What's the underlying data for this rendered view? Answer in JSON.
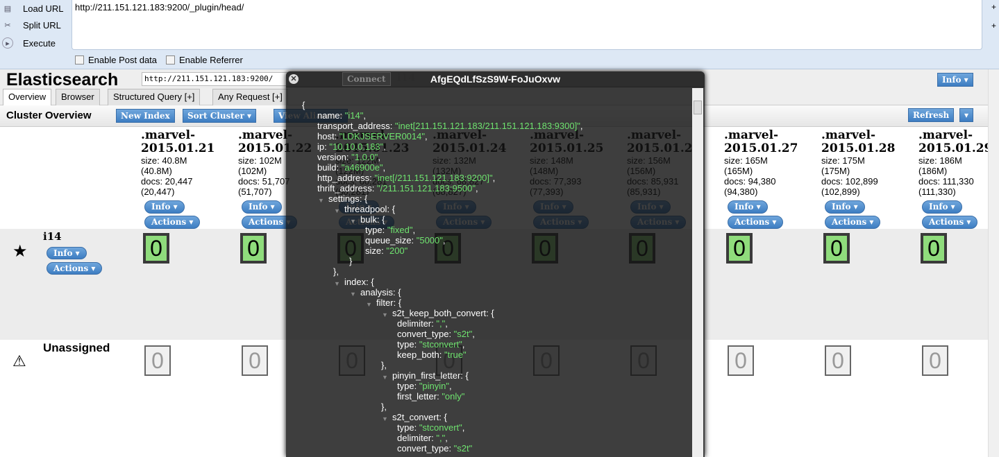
{
  "toolbar": {
    "load_url": "Load URL",
    "split_url": "Split URL",
    "execute": "Execute",
    "url": "http://211.151.121.183:9200/_plugin/head/",
    "enable_post": "Enable Post data",
    "enable_referrer": "Enable Referrer",
    "plus": "+"
  },
  "header": {
    "title": "Elasticsearch",
    "cluster_url": "http://211.151.121.183:9200/",
    "connect": "Connect",
    "cluster_name": "i14",
    "info": "Info ▾"
  },
  "tabs": [
    "Overview",
    "Browser",
    "Structured Query [+]",
    "Any Request [+]"
  ],
  "overview": {
    "label": "Cluster Overview",
    "new_index": "New Index",
    "sort_cluster": "Sort Cluster ▾",
    "view_aliases": "View Aliases ▾",
    "refresh": "Refresh",
    "refresh_menu": "▾"
  },
  "indices": [
    {
      "name": ".marvel-",
      "date": "2015.01.21",
      "size": "size: 40.8M",
      "size2": "(40.8M)",
      "docs": "docs: 20,447",
      "docs2": "(20,447)"
    },
    {
      "name": ".marvel-",
      "date": "2015.01.22",
      "size": "size: 102M",
      "size2": "(102M)",
      "docs": "docs: 51,707",
      "docs2": "(51,707)"
    },
    {
      "name": ".marvel-",
      "date": "2015.01.23",
      "size": "size: 122M",
      "size2": "(122M)",
      "docs": "docs: 60,281",
      "docs2": "(60,281)"
    },
    {
      "name": ".marvel-",
      "date": "2015.01.24",
      "size": "size: 132M",
      "size2": "(132M)",
      "docs": "docs: 68,827",
      "docs2": "(68,827)"
    },
    {
      "name": ".marvel-",
      "date": "2015.01.25",
      "size": "size: 148M",
      "size2": "(148M)",
      "docs": "docs: 77,393",
      "docs2": "(77,393)"
    },
    {
      "name": ".marvel-",
      "date": "2015.01.26",
      "size": "size: 156M",
      "size2": "(156M)",
      "docs": "docs: 85,931",
      "docs2": "(85,931)"
    },
    {
      "name": ".marvel-",
      "date": "2015.01.27",
      "size": "size: 165M",
      "size2": "(165M)",
      "docs": "docs: 94,380",
      "docs2": "(94,380)"
    },
    {
      "name": ".marvel-",
      "date": "2015.01.28",
      "size": "size: 175M",
      "size2": "(175M)",
      "docs": "docs: 102,899",
      "docs2": "(102,899)"
    },
    {
      "name": ".marvel-",
      "date": "2015.01.29",
      "size": "size: 186M",
      "size2": "(186M)",
      "docs": "docs: 111,330",
      "docs2": "(111,330)"
    }
  ],
  "index_info": "Info ▾",
  "index_actions": "Actions ▾",
  "node": {
    "name": "i14",
    "info": "Info ▾",
    "actions": "Actions ▾",
    "shard": "0"
  },
  "unassigned": {
    "name": "Unassigned",
    "shard": "0"
  },
  "modal": {
    "title": "AfgEQdLfSzS9W-FoJuOxvw",
    "close": "✕",
    "lines": [
      {
        "d": 0,
        "t": "{"
      },
      {
        "d": 1,
        "k": "name",
        "v": "\"i14\"",
        "c": ","
      },
      {
        "d": 1,
        "k": "transport_address",
        "v": "\"inet[211.151.121.183/211.151.121.183:9300]\"",
        "c": ","
      },
      {
        "d": 1,
        "k": "host",
        "v": "\"LDKJSERVER0014\"",
        "c": ","
      },
      {
        "d": 1,
        "k": "ip",
        "v": "\"10.10.0.183\"",
        "c": ","
      },
      {
        "d": 1,
        "k": "version",
        "v": "\"1.0.0\"",
        "c": ","
      },
      {
        "d": 1,
        "k": "build",
        "v": "\"a46900e\"",
        "c": ","
      },
      {
        "d": 1,
        "k": "http_address",
        "v": "\"inet[/211.151.121.183:9200]\"",
        "c": ","
      },
      {
        "d": 1,
        "k": "thrift_address",
        "v": "\"/211.151.121.183:9500\"",
        "c": ","
      },
      {
        "d": 1,
        "k": "settings",
        "o": true
      },
      {
        "d": 2,
        "k": "threadpool",
        "o": true
      },
      {
        "d": 3,
        "k": "bulk",
        "o": true
      },
      {
        "d": 4,
        "k": "type",
        "v": "\"fixed\"",
        "c": ","
      },
      {
        "d": 4,
        "k": "queue_size",
        "v": "\"5000\"",
        "c": ","
      },
      {
        "d": 4,
        "k": "size",
        "v": "\"200\""
      },
      {
        "d": 3,
        "t": "}"
      },
      {
        "d": 2,
        "t": "},"
      },
      {
        "d": 2,
        "k": "index",
        "o": true
      },
      {
        "d": 3,
        "k": "analysis",
        "o": true
      },
      {
        "d": 4,
        "k": "filter",
        "o": true
      },
      {
        "d": 5,
        "k": "s2t_keep_both_convert",
        "o": true
      },
      {
        "d": 6,
        "k": "delimiter",
        "v": "\",\"",
        "c": ","
      },
      {
        "d": 6,
        "k": "convert_type",
        "v": "\"s2t\"",
        "c": ","
      },
      {
        "d": 6,
        "k": "type",
        "v": "\"stconvert\"",
        "c": ","
      },
      {
        "d": 6,
        "k": "keep_both",
        "v": "\"true\""
      },
      {
        "d": 5,
        "t": "},"
      },
      {
        "d": 5,
        "k": "pinyin_first_letter",
        "o": true
      },
      {
        "d": 6,
        "k": "type",
        "v": "\"pinyin\"",
        "c": ","
      },
      {
        "d": 6,
        "k": "first_letter",
        "v": "\"only\""
      },
      {
        "d": 5,
        "t": "},"
      },
      {
        "d": 5,
        "k": "s2t_convert",
        "o": true
      },
      {
        "d": 6,
        "k": "type",
        "v": "\"stconvert\"",
        "c": ","
      },
      {
        "d": 6,
        "k": "delimiter",
        "v": "\",\"",
        "c": ","
      },
      {
        "d": 6,
        "k": "convert_type",
        "v": "\"s2t\""
      }
    ]
  }
}
